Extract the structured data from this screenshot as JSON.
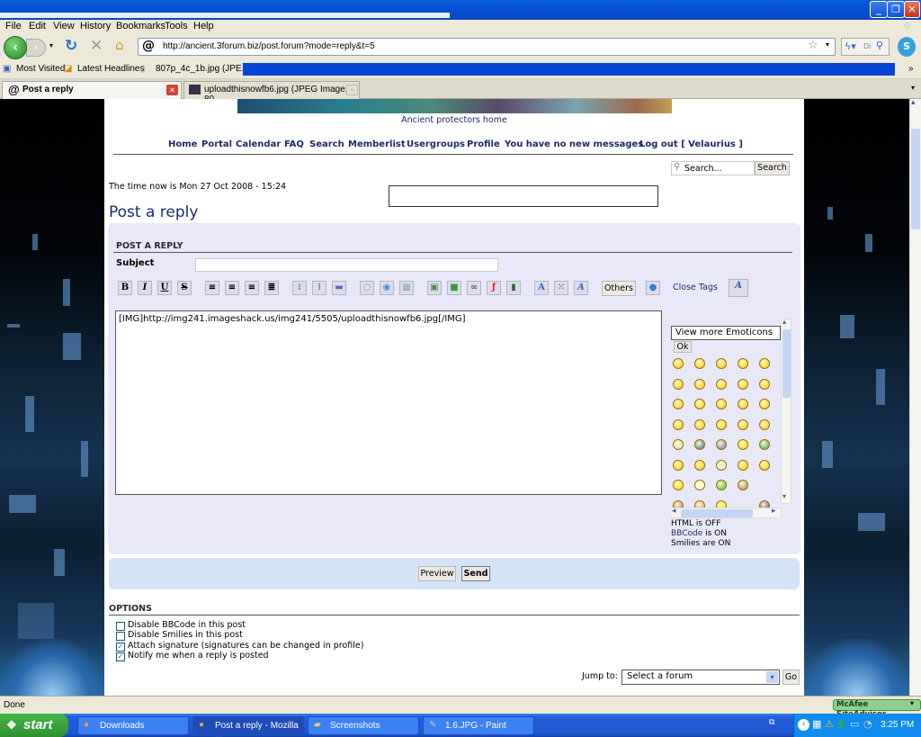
{
  "browser": {
    "menu": [
      "File",
      "Edit",
      "View",
      "History",
      "Bookmarks",
      "Tools",
      "Help"
    ],
    "url": "http://ancient.3forum.biz/post.forum?mode=reply&t=5",
    "search_placeholder": "Di",
    "bookmarks": [
      "Most Visited",
      "Latest Headlines",
      "807p_4c_1b.jpg (JPE..."
    ],
    "tabs": [
      {
        "label": "Post a reply",
        "active": true
      },
      {
        "label": "uploadthisnowfb6.jpg (JPEG Image, 80...",
        "active": false
      }
    ],
    "chevron": "»",
    "status": "Done",
    "mcafee": "McAfee SiteAdvisor"
  },
  "forum": {
    "home_caption": "Ancient protectors home",
    "nav": [
      "Home",
      "Portal",
      "Calendar",
      "FAQ",
      "Search",
      "Memberlist",
      "Usergroups",
      "Profile",
      "You have no new messages",
      "Log out [ Velaurius ]"
    ],
    "search_placeholder": "Search...",
    "search_button": "Search",
    "time_text": "The time now is Mon 27 Oct 2008 - 15:24",
    "page_title": "Post a reply",
    "section_title": "POST A REPLY",
    "subject_label": "Subject",
    "subject_value": "",
    "toolbar": {
      "bold": "B",
      "italic": "I",
      "underline": "U",
      "strike": "S",
      "others": "Others",
      "close_tags": "Close Tags"
    },
    "message": "[IMG]http://img241.imageshack.us/img241/5505/uploadthisnowfb6.jpg[/IMG]",
    "emoticons_select": "View more Emoticons",
    "emoticons_ok": "Ok",
    "html_status": "HTML is OFF",
    "bbcode_link": "BBCode",
    "bbcode_status": " is ON",
    "smilies_status": "Smilies are ON",
    "preview_button": "Preview",
    "send_button": "Send",
    "options_title": "OPTIONS",
    "options": [
      {
        "label": "Disable BBCode in this post",
        "checked": false
      },
      {
        "label": "Disable Smilies in this post",
        "checked": false
      },
      {
        "label": "Attach signature (signatures can be changed in profile)",
        "checked": true
      },
      {
        "label": "Notify me when a reply is posted",
        "checked": true
      }
    ],
    "jump_label": "Jump to:",
    "jump_value": "Select a forum",
    "go_button": "Go"
  },
  "taskbar": {
    "start": "start",
    "items": [
      {
        "label": "Downloads",
        "active": false
      },
      {
        "label": "Post a reply - Mozilla ...",
        "active": true
      },
      {
        "label": "Screenshots",
        "active": false
      },
      {
        "label": "1.6.JPG - Paint",
        "active": false
      }
    ],
    "clock": "3:25 PM"
  }
}
